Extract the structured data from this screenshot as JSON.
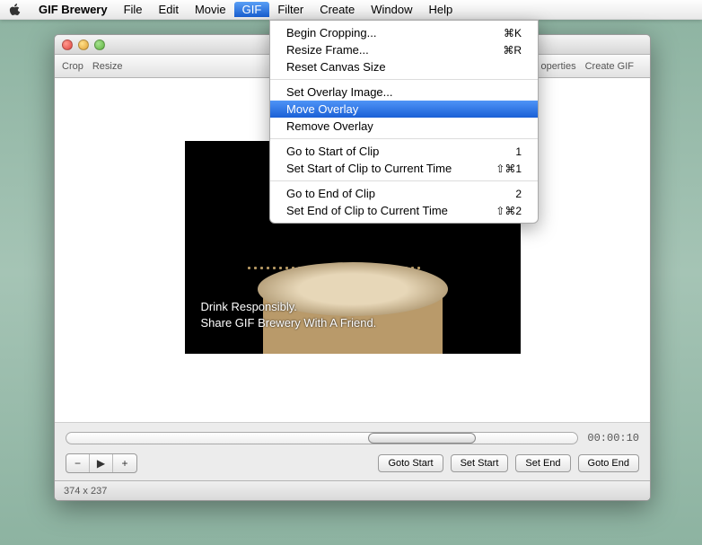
{
  "menubar": {
    "app_name": "GIF Brewery",
    "items": [
      "File",
      "Edit",
      "Movie",
      "GIF",
      "Filter",
      "Create",
      "Window",
      "Help"
    ],
    "open_index": 3
  },
  "dropdown": {
    "groups": [
      [
        {
          "label": "Begin Cropping...",
          "shortcut": "⌘K"
        },
        {
          "label": "Resize Frame...",
          "shortcut": "⌘R"
        },
        {
          "label": "Reset Canvas Size",
          "shortcut": ""
        }
      ],
      [
        {
          "label": "Set Overlay Image...",
          "shortcut": ""
        },
        {
          "label": "Move Overlay",
          "shortcut": "",
          "highlight": true
        },
        {
          "label": "Remove Overlay",
          "shortcut": ""
        }
      ],
      [
        {
          "label": "Go to Start of Clip",
          "shortcut": "1"
        },
        {
          "label": "Set Start of Clip to Current Time",
          "shortcut": "⇧⌘1"
        }
      ],
      [
        {
          "label": "Go to End of Clip",
          "shortcut": "2"
        },
        {
          "label": "Set End of Clip to Current Time",
          "shortcut": "⇧⌘2"
        }
      ]
    ]
  },
  "window": {
    "toolbar": {
      "left": [
        "Crop",
        "Resize"
      ],
      "right": [
        "operties",
        "Create GIF"
      ]
    },
    "preview": {
      "caption_line1": "Drink Responsibly.",
      "caption_line2": "Share GIF Brewery With A Friend."
    },
    "controls": {
      "time": "00:00:10",
      "step_minus": "−",
      "step_play": "▶",
      "step_plus": "+",
      "buttons": [
        "Goto Start",
        "Set Start",
        "Set End",
        "Goto End"
      ]
    },
    "status": "374 x 237"
  }
}
